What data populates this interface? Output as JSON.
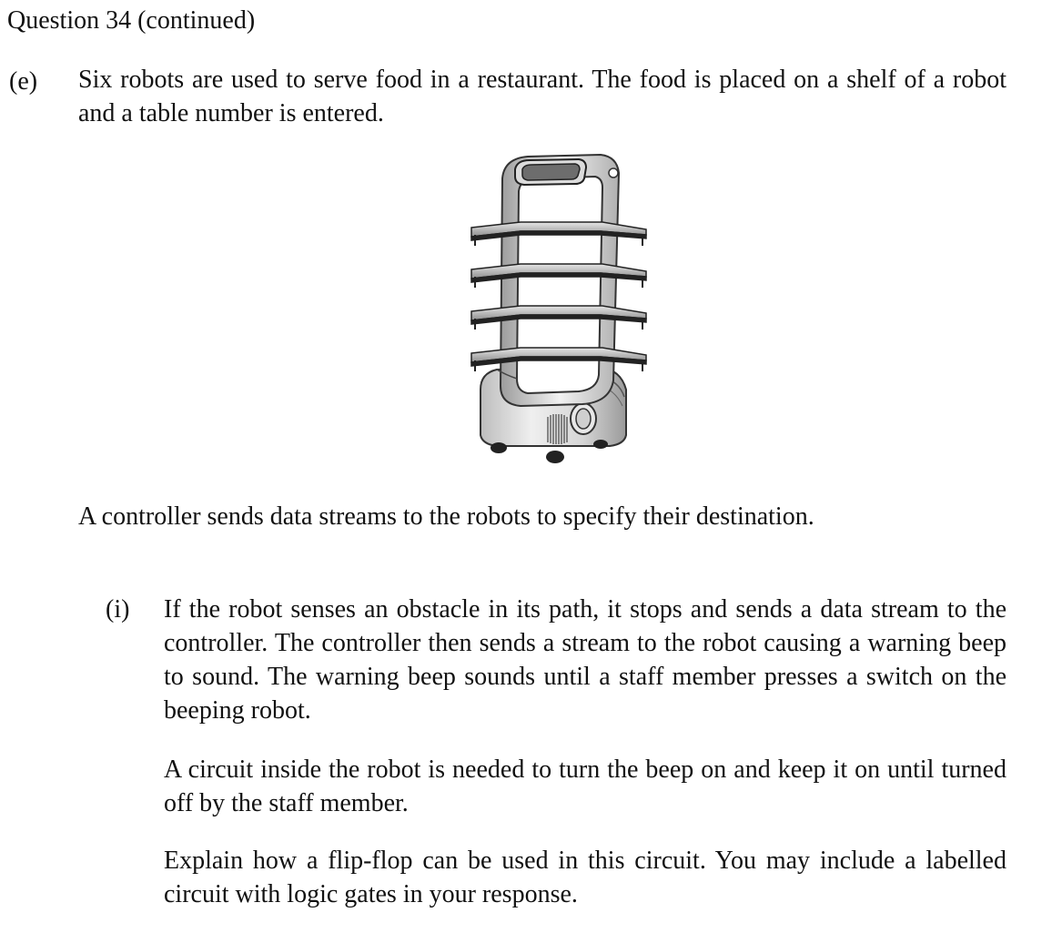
{
  "header": {
    "title": "Question 34 (continued)"
  },
  "part_e": {
    "label": "(e)",
    "intro": "Six robots are used to serve food in a restaurant. The food is placed on a shelf of a robot and a table number is entered.",
    "figure_icon": "serving-robot-illustration",
    "controller_text": "A controller sends data streams to the robots to specify their destination."
  },
  "part_i": {
    "label": "(i)",
    "paragraph_1": "If the robot senses an obstacle in its path, it stops and sends a data stream to the controller. The controller then sends a stream to the robot causing a warning beep to sound. The warning beep sounds until a staff member presses a switch on the beeping robot.",
    "paragraph_2": "A circuit inside the robot is needed to turn the beep on and keep it on until turned off by the staff member.",
    "paragraph_3": "Explain how a flip-flop can be used in this circuit. You may include a labelled circuit with logic gates in your response."
  }
}
